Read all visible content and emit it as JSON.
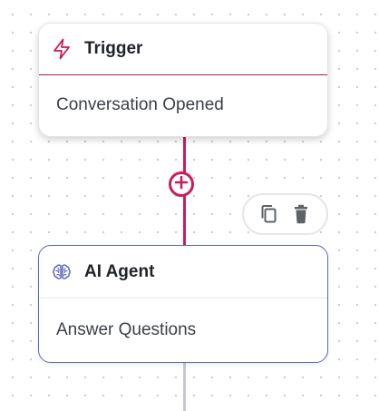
{
  "trigger_node": {
    "icon": "lightning-bolt-icon",
    "title": "Trigger",
    "subtitle": "Conversation Opened"
  },
  "agent_node": {
    "icon": "brain-icon",
    "title": "AI Agent",
    "subtitle": "Answer Questions"
  },
  "add_step": {
    "icon": "plus-circle-icon"
  },
  "node_toolbar": {
    "icons": [
      "copy-icon",
      "trash-icon"
    ]
  },
  "colors": {
    "accent": "#c81e5b",
    "agent_border": "#5b69b8",
    "connector_inactive": "#c5c9cf"
  }
}
